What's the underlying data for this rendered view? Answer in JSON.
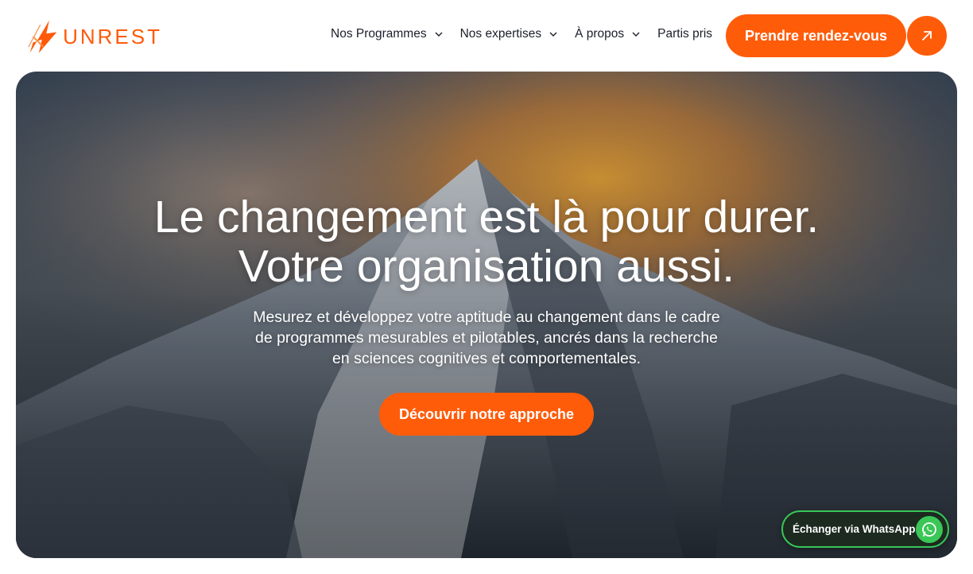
{
  "header": {
    "logo_text": "UNREST",
    "nav": [
      {
        "label": "Nos Programmes",
        "dropdown": true
      },
      {
        "label": "Nos expertises",
        "dropdown": true
      },
      {
        "label": "À propos",
        "dropdown": true
      },
      {
        "label": "Partis pris",
        "dropdown": false
      }
    ],
    "cta_label": "Prendre rendez-vous"
  },
  "hero": {
    "title_line1": "Le changement est là pour durer.",
    "title_line2": "Votre organisation aussi.",
    "subtitle_line1": "Mesurez et développez votre aptitude  au changement dans le cadre",
    "subtitle_line2": "de programmes mesurables et pilotables, ancrés dans la recherche",
    "subtitle_line3": "en sciences cognitives et comportementales.",
    "button_label": "Découvrir notre approche"
  },
  "whatsapp": {
    "label": "Échanger via WhatsApp"
  },
  "colors": {
    "accent": "#ff5c0a",
    "whatsapp_green": "#3ac757",
    "text_dark": "#1b1f2a"
  },
  "icons": {
    "logo": "unrest-logo-icon",
    "nav_chevron": "chevron-down-icon",
    "cta_arrow": "arrow-up-right-icon",
    "whatsapp": "whatsapp-icon"
  }
}
